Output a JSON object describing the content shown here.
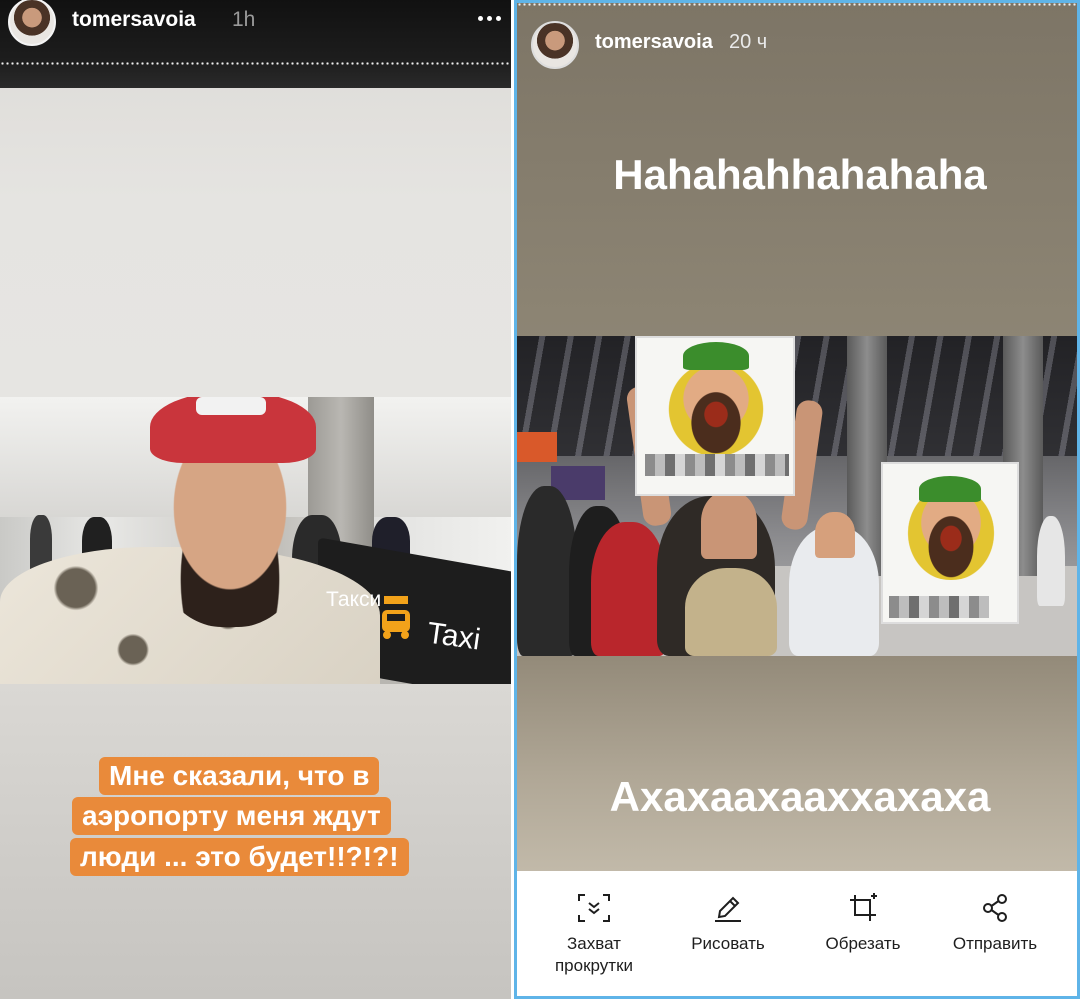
{
  "left_story": {
    "username": "tomersavoia",
    "time": "1h",
    "taxi_ru": "Такси",
    "taxi_en": "Taxi",
    "caption_lines": [
      "Мне сказали, что в",
      "аэропорту меня ждут",
      "люди ... это будет!!?!?!"
    ]
  },
  "right_story": {
    "username": "tomersavoia",
    "time": "20 ч",
    "text_top": "Hahahahhahahaha",
    "text_bottom": "Ахахаахааххахаха"
  },
  "toolbar": {
    "scroll_capture_line1": "Захват",
    "scroll_capture_line2": "прокрутки",
    "draw": "Рисовать",
    "crop": "Обрезать",
    "share": "Отправить"
  },
  "colors": {
    "caption_bg": "#e98a3a",
    "right_border": "#5fb4e8",
    "right_bg": "#8b8373"
  },
  "icons": [
    "more-icon",
    "scroll-capture-icon",
    "pencil-icon",
    "crop-icon",
    "share-icon",
    "taxi-car-icon"
  ]
}
